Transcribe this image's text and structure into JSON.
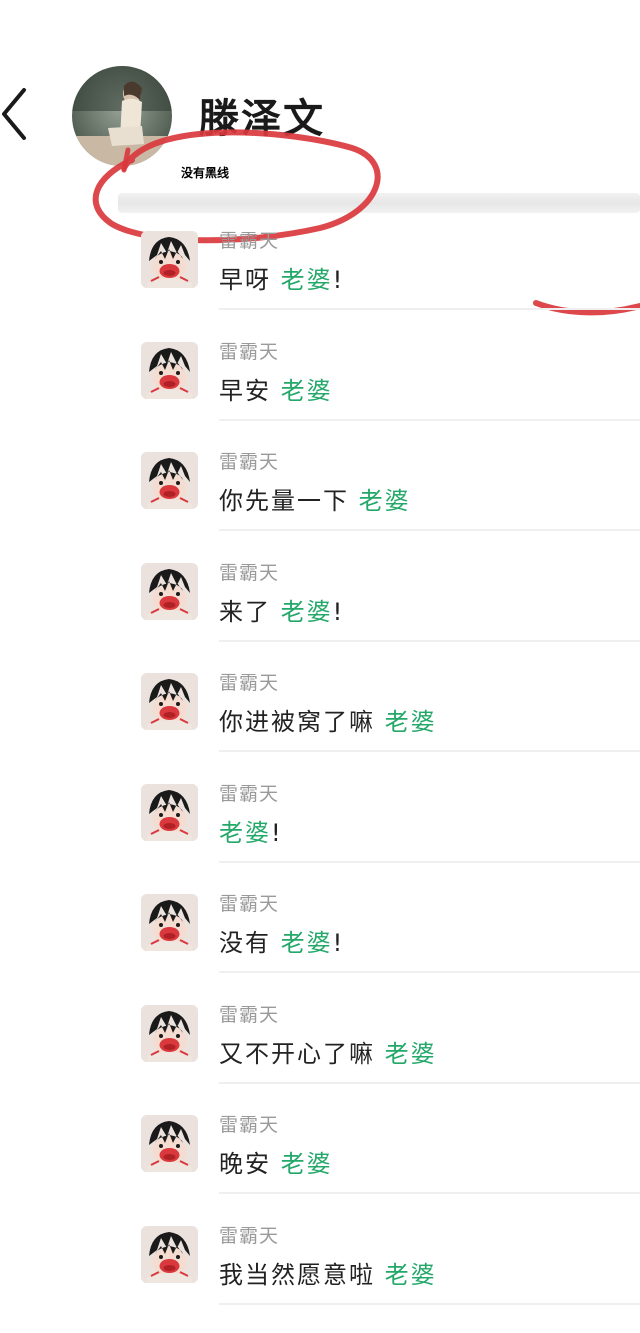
{
  "header": {
    "contact_name": "滕泽文"
  },
  "annotation": {
    "text": "没有黑线",
    "circle_color": "#d9383d"
  },
  "accent_color": "#24a86a",
  "icons": {
    "back": "chevron-left-icon",
    "avatar_main": "contact-avatar",
    "avatar_sender": "sender-avatar"
  },
  "messages": [
    {
      "sender": "雷霸天",
      "text": "早呀",
      "highlight": "老婆",
      "suffix": "!"
    },
    {
      "sender": "雷霸天",
      "text": "早安",
      "highlight": "老婆",
      "suffix": ""
    },
    {
      "sender": "雷霸天",
      "text": "你先量一下",
      "highlight": "老婆",
      "suffix": ""
    },
    {
      "sender": "雷霸天",
      "text": "来了",
      "highlight": "老婆",
      "suffix": "!"
    },
    {
      "sender": "雷霸天",
      "text": "你进被窝了嘛",
      "highlight": "老婆",
      "suffix": ""
    },
    {
      "sender": "雷霸天",
      "text": "",
      "highlight": "老婆",
      "suffix": "!"
    },
    {
      "sender": "雷霸天",
      "text": "没有",
      "highlight": "老婆",
      "suffix": "!"
    },
    {
      "sender": "雷霸天",
      "text": "又不开心了嘛",
      "highlight": "老婆",
      "suffix": ""
    },
    {
      "sender": "雷霸天",
      "text": "晚安",
      "highlight": "老婆",
      "suffix": ""
    },
    {
      "sender": "雷霸天",
      "text": "我当然愿意啦",
      "highlight": "老婆",
      "suffix": ""
    }
  ]
}
